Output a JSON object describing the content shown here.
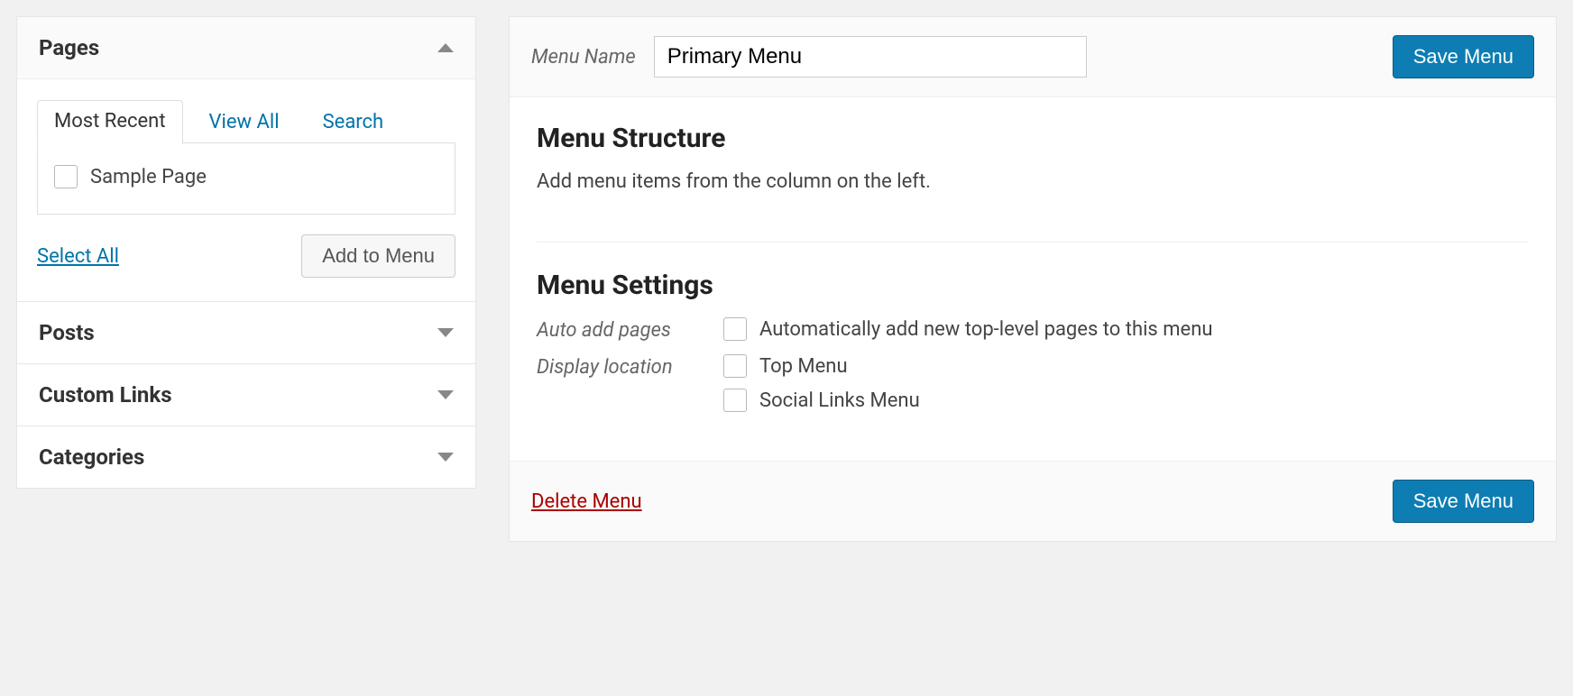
{
  "sidebar": {
    "pages": {
      "title": "Pages",
      "expanded": true,
      "tabs": {
        "most_recent": "Most Recent",
        "view_all": "View All",
        "search": "Search",
        "active": "most_recent"
      },
      "items": [
        {
          "label": "Sample Page"
        }
      ],
      "select_all": "Select All",
      "add_to_menu": "Add to Menu"
    },
    "posts": {
      "title": "Posts",
      "expanded": false
    },
    "custom_links": {
      "title": "Custom Links",
      "expanded": false
    },
    "categories": {
      "title": "Categories",
      "expanded": false
    }
  },
  "main": {
    "menu_name_label": "Menu Name",
    "menu_name_value": "Primary Menu",
    "save_button": "Save Menu",
    "structure": {
      "heading": "Menu Structure",
      "description": "Add menu items from the column on the left."
    },
    "settings": {
      "heading": "Menu Settings",
      "auto_add_label": "Auto add pages",
      "auto_add_option": "Automatically add new top-level pages to this menu",
      "display_location_label": "Display location",
      "locations": [
        "Top Menu",
        "Social Links Menu"
      ]
    },
    "delete_menu": "Delete Menu"
  }
}
